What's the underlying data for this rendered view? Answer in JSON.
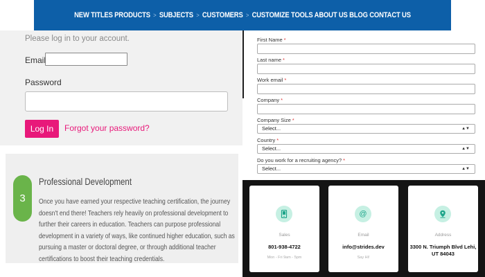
{
  "nav": {
    "items": [
      "NEW TITLES PRODUCTS",
      "SUBJECTS",
      "CUSTOMERS",
      "CUSTOMIZE TOOLS ABOUT US BLOG CONTACT US"
    ],
    "separator": ">"
  },
  "login": {
    "note": "Please log in to your account.",
    "email_label": "Email",
    "email_value": "",
    "password_label": "Password",
    "password_value": "",
    "login_button": "Log In",
    "forgot_link": "Forgot your password?"
  },
  "prodev": {
    "step_number": "3",
    "title": "Professional Development",
    "body": "Once you have earned your respective teaching certification, the journey doesn't end there! Teachers rely heavily on professional development to further their careers in education. Teachers can purpose professional development in a variety of ways, like continued higher education, such as pursuing a master or doctoral degree, or through additional teacher certifications to boost their teaching credentials.",
    "accent_color": "#6ab44a"
  },
  "form": {
    "first_name_label": "First Name",
    "last_name_label": "Last name",
    "work_email_label": "Work email",
    "company_label": "Company",
    "company_size_label": "Company Size",
    "company_size_value": "Select...",
    "country_label": "Country",
    "country_value": "Select...",
    "agency_label": "Do you work for a recruiting agency?",
    "agency_value": "Select...",
    "required_mark": "*"
  },
  "contact": {
    "cards": [
      {
        "icon": "phone-icon",
        "kind": "Sales",
        "value": "801-938-4722",
        "note": "Mon - Fri 9am - 5pm"
      },
      {
        "icon": "at-sign-icon",
        "kind": "Email",
        "value": "info@strides.dev",
        "note": "Say Hi!"
      },
      {
        "icon": "map-pin-icon",
        "kind": "Address",
        "value": "3300 N. Triumph Blvd Lehi, UT 84043",
        "note": ""
      }
    ],
    "accent_color": "#1ea58a"
  },
  "colors": {
    "nav_bg": "#0d5fa8",
    "brand_pink": "#e8197a",
    "contact_bg": "#141414"
  }
}
